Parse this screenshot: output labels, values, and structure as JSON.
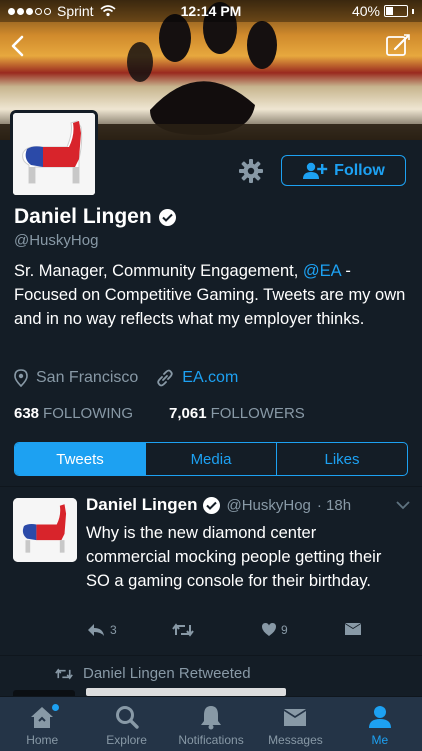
{
  "status_bar": {
    "carrier": "Sprint",
    "time": "12:14 PM",
    "battery": "40%",
    "battery_level": 0.4
  },
  "profile": {
    "name": "Daniel Lingen",
    "handle": "@HuskyHog",
    "bio_before": "Sr. Manager, Community Engagement, ",
    "bio_mention": "@EA",
    "bio_after": " - Focused on Competitive Gaming. Tweets are my own and in no way reflects what my employer thinks.",
    "location": "San Francisco",
    "website": "EA.com",
    "following_count": "638",
    "following_label": "FOLLOWING",
    "followers_count": "7,061",
    "followers_label": "FOLLOWERS",
    "follow_label": "Follow"
  },
  "tabs": [
    {
      "label": "Tweets",
      "active": true
    },
    {
      "label": "Media",
      "active": false
    },
    {
      "label": "Likes",
      "active": false
    }
  ],
  "tweet": {
    "name": "Daniel Lingen",
    "handle": "@HuskyHog",
    "time": "· 18h",
    "text": "Why is the new diamond center commercial mocking people getting their SO a gaming console for their birthday.",
    "replies": "3",
    "likes": "9"
  },
  "retweet_notice": "Daniel Lingen Retweeted",
  "tab_bar": [
    {
      "label": "Home",
      "icon": "home-icon"
    },
    {
      "label": "Explore",
      "icon": "search-icon"
    },
    {
      "label": "Notifications",
      "icon": "bell-icon"
    },
    {
      "label": "Messages",
      "icon": "envelope-icon"
    },
    {
      "label": "Me",
      "icon": "person-icon"
    }
  ],
  "colors": {
    "background": "#141d26",
    "accent": "#1da1f2",
    "muted": "#8899a6",
    "tab_bar": "#243447"
  }
}
